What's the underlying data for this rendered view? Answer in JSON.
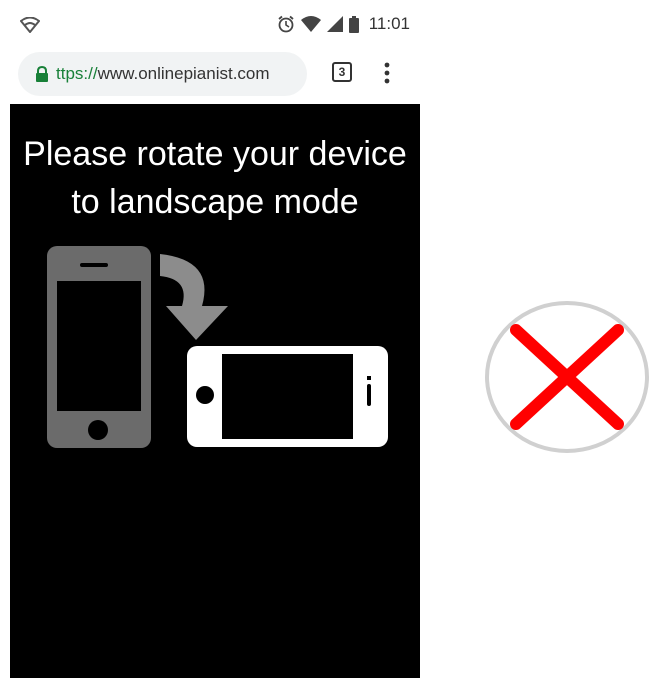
{
  "status_bar": {
    "left_icon": "signal-strength-icon",
    "icons": [
      "alarm-icon",
      "wifi-icon",
      "cell-signal-icon",
      "battery-icon"
    ],
    "time": "11:01"
  },
  "address_bar": {
    "lock_icon": "lock-icon",
    "url_scheme": "ttps://",
    "url_host": "www.onlinepianist.com",
    "tab_count": "3",
    "menu_icon": "more-vert-icon"
  },
  "page": {
    "message_line1": "Please rotate your device",
    "message_line2": "to landscape mode"
  },
  "overlay": {
    "icon": "close-x-icon",
    "color": "#ff0000"
  },
  "colors": {
    "lock_green": "#188038",
    "url_pill_bg": "#f1f3f4",
    "page_bg": "#000000",
    "portrait_phone": "#6b6b6b",
    "arrow": "#8c8c8c"
  }
}
